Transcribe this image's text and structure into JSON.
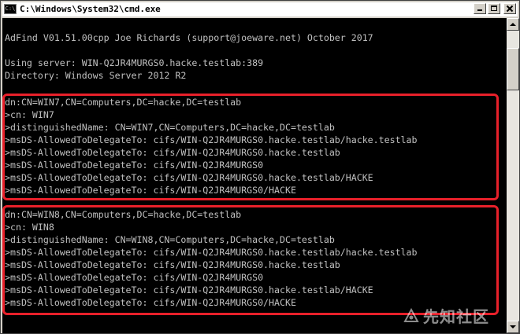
{
  "window": {
    "title": "C:\\Windows\\System32\\cmd.exe",
    "icon_label": "C:\\"
  },
  "console": {
    "lines": [
      "AdFind V01.51.00cpp Joe Richards (support@joeware.net) October 2017",
      "",
      "Using server: WIN-Q2JR4MURGS0.hacke.testlab:389",
      "Directory: Windows Server 2012 R2",
      "",
      "dn:CN=WIN7,CN=Computers,DC=hacke,DC=testlab",
      ">cn: WIN7",
      ">distinguishedName: CN=WIN7,CN=Computers,DC=hacke,DC=testlab",
      ">msDS-AllowedToDelegateTo: cifs/WIN-Q2JR4MURGS0.hacke.testlab/hacke.testlab",
      ">msDS-AllowedToDelegateTo: cifs/WIN-Q2JR4MURGS0.hacke.testlab",
      ">msDS-AllowedToDelegateTo: cifs/WIN-Q2JR4MURGS0",
      ">msDS-AllowedToDelegateTo: cifs/WIN-Q2JR4MURGS0.hacke.testlab/HACKE",
      ">msDS-AllowedToDelegateTo: cifs/WIN-Q2JR4MURGS0/HACKE",
      "",
      "dn:CN=WIN8,CN=Computers,DC=hacke,DC=testlab",
      ">cn: WIN8",
      ">distinguishedName: CN=WIN8,CN=Computers,DC=hacke,DC=testlab",
      ">msDS-AllowedToDelegateTo: cifs/WIN-Q2JR4MURGS0.hacke.testlab/hacke.testlab",
      ">msDS-AllowedToDelegateTo: cifs/WIN-Q2JR4MURGS0.hacke.testlab",
      ">msDS-AllowedToDelegateTo: cifs/WIN-Q2JR4MURGS0",
      ">msDS-AllowedToDelegateTo: cifs/WIN-Q2JR4MURGS0.hacke.testlab/HACKE",
      ">msDS-AllowedToDelegateTo: cifs/WIN-Q2JR4MURGS0/HACKE"
    ],
    "colors": {
      "background": "#000000",
      "text": "#c0c0c0",
      "highlight": "#e8202a"
    }
  },
  "watermark": {
    "text": "先知社区",
    "icon": "xianzhi-logo-icon"
  },
  "icons": {
    "window_icon": "cmd-icon",
    "minimize": "minimize-icon",
    "maximize": "maximize-icon",
    "close": "close-icon",
    "scroll_up": "arrow-up-icon",
    "scroll_down": "arrow-down-icon"
  }
}
